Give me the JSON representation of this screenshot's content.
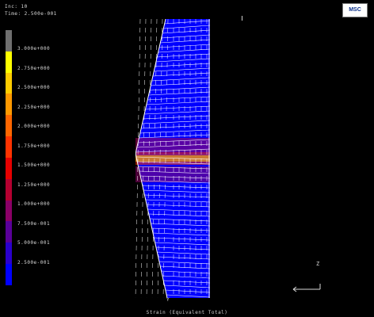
{
  "header": {
    "line1": "Inc:   10",
    "line2": "Time:   2.500e-001"
  },
  "logo": {
    "text": "MSC"
  },
  "legend": {
    "colors": [
      "#6f6f6f",
      "#ffff00",
      "#ffcc00",
      "#ff9900",
      "#ff6600",
      "#ff3300",
      "#e60000",
      "#b40030",
      "#8a0066",
      "#5a0099",
      "#2a00cc",
      "#0000ff"
    ],
    "labels": [
      "3.000e+000",
      "2.750e+000",
      "2.500e+000",
      "2.250e+000",
      "2.000e+000",
      "1.750e+000",
      "1.500e+000",
      "1.250e+000",
      "1.000e+000",
      "7.500e-001",
      "5.000e-001",
      "2.500e-001"
    ]
  },
  "mesh": {
    "x_label": "Y",
    "mesh_color": "#ffffff",
    "field_color": "#0000ff"
  },
  "triad": {
    "label": "Z"
  },
  "caption": "Strain (Equivalent Total)"
}
